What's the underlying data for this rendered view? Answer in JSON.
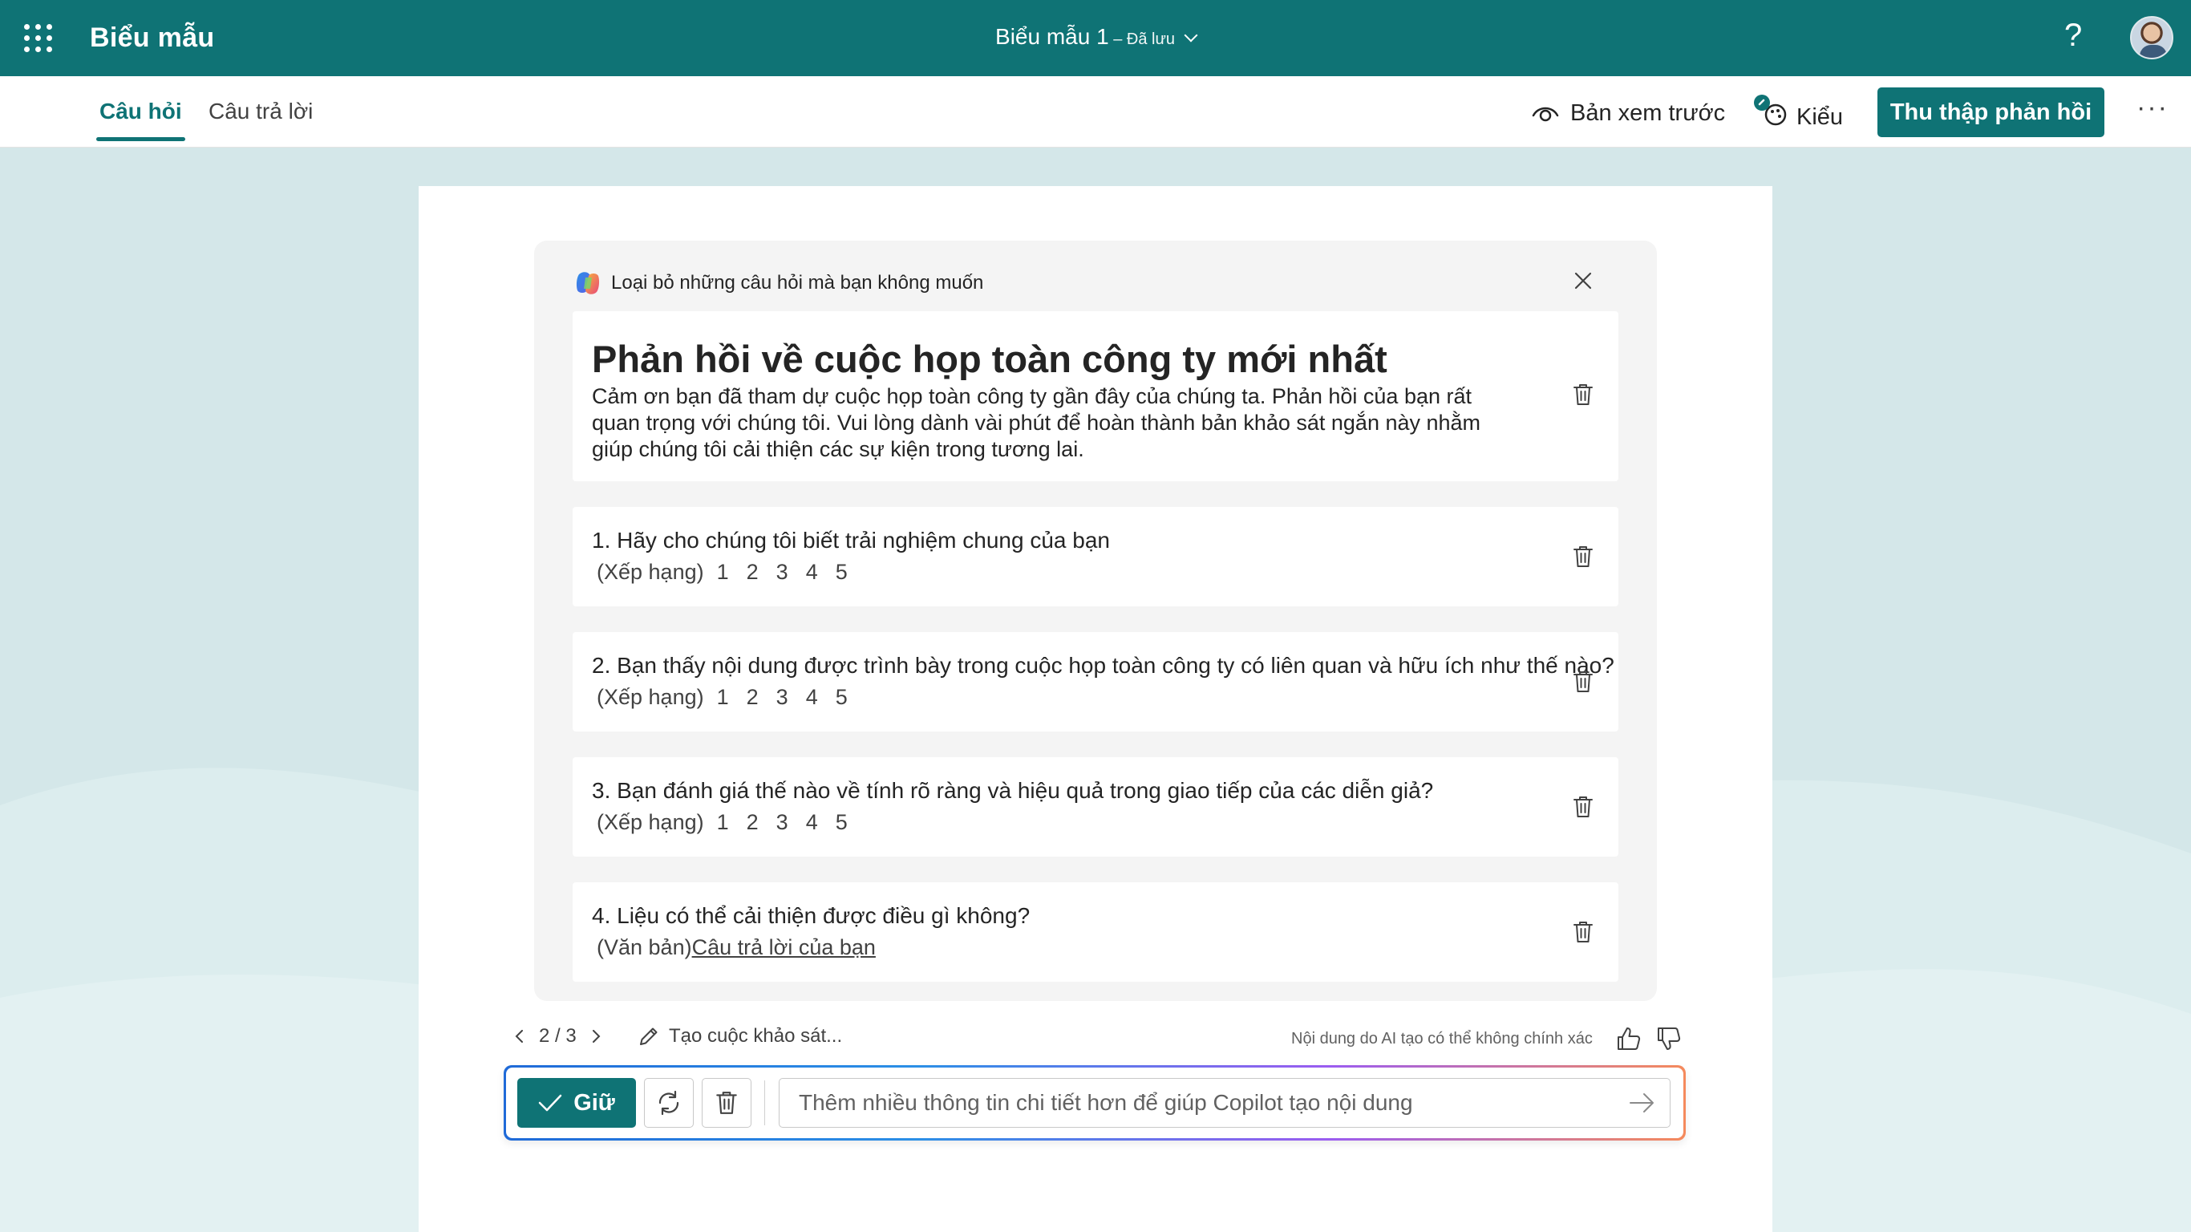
{
  "topbar": {
    "app_name": "Biểu mẫu",
    "doc_title": "Biểu mẫu 1",
    "save_status": " – Đã lưu",
    "help_label": "?",
    "accent_color": "#0f7375"
  },
  "tabs": [
    {
      "label": "Câu hỏi",
      "active": true
    },
    {
      "label": "Câu trả lời",
      "active": false
    }
  ],
  "commands": {
    "preview_label": "Bản xem trước",
    "style_label": "Kiểu",
    "collect_label": "Thu thập phản hồi",
    "more_label": "···"
  },
  "copilot_card": {
    "header": "Loại bỏ những câu hỏi mà bạn không muốn",
    "form_title": "Phản hồi về cuộc họp toàn công ty mới nhất",
    "form_description": "Cảm ơn bạn đã tham dự cuộc họp toàn công ty gần đây của chúng ta. Phản hồi của bạn rất quan trọng với chúng tôi. Vui lòng dành vài phút để hoàn thành bản khảo sát ngắn này nhằm giúp chúng tôi cải thiện các sự kiện trong tương lai.",
    "questions": [
      {
        "text": "1. Hãy cho chúng tôi biết trải nghiệm chung của bạn",
        "type": "(Xếp hạng)",
        "options": [
          "1",
          "2",
          "3",
          "4",
          "5"
        ]
      },
      {
        "text": "2. Bạn thấy nội dung được trình bày trong cuộc họp toàn công ty có liên quan và hữu ích như thế nào?",
        "type": "(Xếp hạng)",
        "options": [
          "1",
          "2",
          "3",
          "4",
          "5"
        ]
      },
      {
        "text": "3. Bạn đánh giá thế nào về tính rõ ràng và hiệu quả trong giao tiếp của các diễn giả?",
        "type": "(Xếp hạng)",
        "options": [
          "1",
          "2",
          "3",
          "4",
          "5"
        ]
      },
      {
        "text": "4. Liệu có thể cải thiện được điều gì không?",
        "type": "(Văn bản)",
        "answer_placeholder": "Câu trả lời của bạn"
      }
    ]
  },
  "footer": {
    "pager": "2 / 3",
    "create_label": "Tạo cuộc khảo sát...",
    "disclaimer": "Nội dung do AI tạo có thể không chính xác"
  },
  "prompt": {
    "keep_label": "Giữ",
    "placeholder": "Thêm nhiều thông tin chi tiết hơn để giúp Copilot tạo nội dung"
  }
}
